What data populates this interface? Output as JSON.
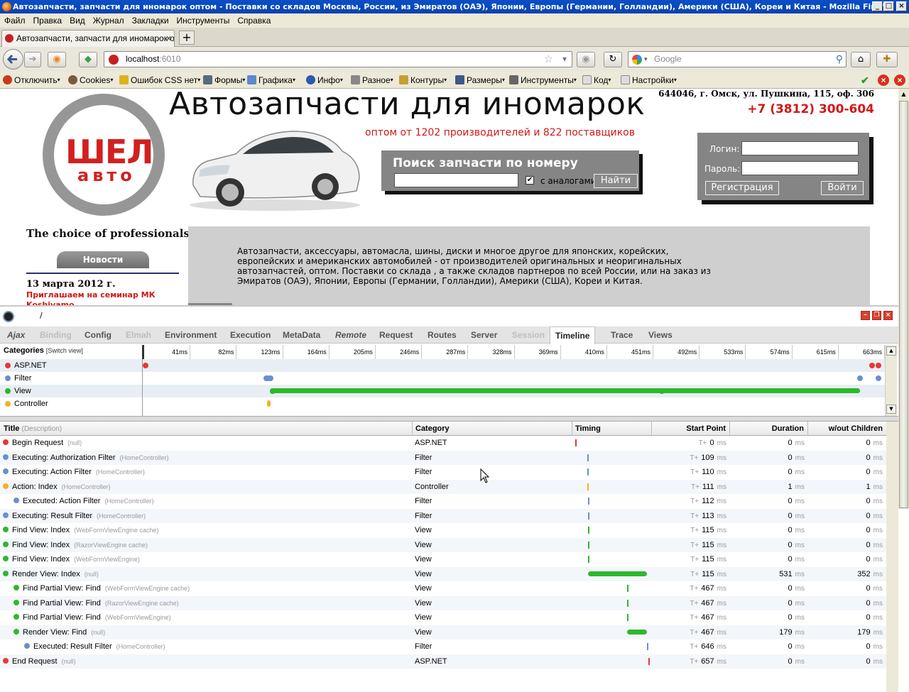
{
  "window": {
    "title": "Автозапчасти, запчасти для иномарок оптом - Поставки со складов Москвы, России, из Эмиратов (ОАЭ), Японии, Европы (Германии, Голландии), Америки (США), Кореи и Китая - Mozilla Firefox"
  },
  "menu": [
    "Файл",
    "Правка",
    "Вид",
    "Журнал",
    "Закладки",
    "Инструменты",
    "Справка"
  ],
  "tab": {
    "label": "Автозапчасти, запчасти для иномарок оп..."
  },
  "url": {
    "host": "localhost",
    "port": ":6010"
  },
  "search": {
    "placeholder": "Google"
  },
  "webdev": [
    "Отключить",
    "Cookies",
    "Ошибок CSS нет",
    "Формы",
    "Графика",
    "Инфо",
    "Разное",
    "Контуры",
    "Размеры",
    "Инструменты",
    "Код",
    "Настройки"
  ],
  "site": {
    "logo_main": "ШЕЛ",
    "logo_sub": "авто",
    "headline": "Автозапчасти для иномарок",
    "subhead": "оптом от 1202 производителей и 822 поставщиков",
    "address": "644046, г. Омск, ул. Пушкина, 115, оф. 306",
    "phone": "+7 (3812) 300-604",
    "search_title": "Поиск запчасти по номеру",
    "analogs": "с аналогами",
    "find": "Найти",
    "login_label": "Логин:",
    "password_label": "Пароль:",
    "register": "Регистрация",
    "login_btn": "Войти",
    "choice": "The choice of professionals",
    "news_btn": "Новости",
    "news_date": "13 марта 2012 г.",
    "news_link": "Приглашаем на семинар МК Koshivamo",
    "intro": "Автозапчасти, аксессуары, автомасла, шины, диски и многое другое для японских, корейских, европейских и американских автомобилей - от производителей оригинальных и неоригинальных автозапчастей, оптом. Поставки со склада , а также складов партнеров по всей России, или на заказ из Эмиратов (ОАЭ), Японии, Европы (Германии, Голландии), Америки (США), Кореи и Китая."
  },
  "glimpse": {
    "slash": "/",
    "tabs": [
      {
        "label": "Ajax",
        "state": "italic"
      },
      {
        "label": "Binding",
        "state": "disabled"
      },
      {
        "label": "Config",
        "state": "normal"
      },
      {
        "label": "Elmah",
        "state": "disabled"
      },
      {
        "label": "Environment",
        "state": "normal"
      },
      {
        "label": "Execution",
        "state": "normal"
      },
      {
        "label": "MetaData",
        "state": "normal"
      },
      {
        "label": "Remote",
        "state": "italic"
      },
      {
        "label": "Request",
        "state": "normal"
      },
      {
        "label": "Routes",
        "state": "normal"
      },
      {
        "label": "Server",
        "state": "normal"
      },
      {
        "label": "Session",
        "state": "disabled"
      },
      {
        "label": "Timeline",
        "state": "active"
      },
      {
        "label": "Trace",
        "state": "normal"
      },
      {
        "label": "Views",
        "state": "normal"
      }
    ],
    "categories_title": "Categories",
    "switch_view": "[Switch view]",
    "categories": [
      {
        "name": "ASP.NET",
        "color": "#e53935"
      },
      {
        "name": "Filter",
        "color": "#6a8fd0"
      },
      {
        "name": "View",
        "color": "#2db82d"
      },
      {
        "name": "Controller",
        "color": "#f2b12b"
      }
    ],
    "ticks": [
      "41ms",
      "82ms",
      "123ms",
      "164ms",
      "205ms",
      "246ms",
      "287ms",
      "328ms",
      "369ms",
      "410ms",
      "451ms",
      "492ms",
      "533ms",
      "574ms",
      "615ms",
      "663ms"
    ],
    "total_ms": 663,
    "columns": {
      "title": "Title",
      "desc": "(Description)",
      "category": "Category",
      "timing": "Timing",
      "start": "Start Point",
      "duration": "Duration",
      "without": "w/out Children"
    },
    "ms": "ms",
    "tplus": "T+",
    "events": [
      {
        "title": "Begin Request",
        "desc": "(null)",
        "cat": "ASP.NET",
        "start": 0,
        "duration": 0,
        "self": 0,
        "indent": 0
      },
      {
        "title": "Executing: Authorization Filter",
        "desc": "(HomeController)",
        "cat": "Filter",
        "start": 109,
        "duration": 0,
        "self": 0,
        "indent": 0
      },
      {
        "title": "Executing: Action Filter",
        "desc": "(HomeController)",
        "cat": "Filter",
        "start": 110,
        "duration": 0,
        "self": 0,
        "indent": 0
      },
      {
        "title": "Action: Index",
        "desc": "(HomeController)",
        "cat": "Controller",
        "start": 111,
        "duration": 1,
        "self": 1,
        "indent": 0
      },
      {
        "title": "Executed: Action Filter",
        "desc": "(HomeController)",
        "cat": "Filter",
        "start": 112,
        "duration": 0,
        "self": 0,
        "indent": 1
      },
      {
        "title": "Executing: Result Filter",
        "desc": "(HomeController)",
        "cat": "Filter",
        "start": 113,
        "duration": 0,
        "self": 0,
        "indent": 0
      },
      {
        "title": "Find View: Index",
        "desc": "(WebFormViewEngine cache)",
        "cat": "View",
        "start": 115,
        "duration": 0,
        "self": 0,
        "indent": 0
      },
      {
        "title": "Find View: Index",
        "desc": "(RazorViewEngine cache)",
        "cat": "View",
        "start": 115,
        "duration": 0,
        "self": 0,
        "indent": 0
      },
      {
        "title": "Find View: Index",
        "desc": "(WebFormViewEngine)",
        "cat": "View",
        "start": 115,
        "duration": 0,
        "self": 0,
        "indent": 0
      },
      {
        "title": "Render View: Index",
        "desc": "(null)",
        "cat": "View",
        "start": 115,
        "duration": 531,
        "self": 352,
        "indent": 0
      },
      {
        "title": "Find Partial View: Find",
        "desc": "(WebFormViewEngine cache)",
        "cat": "View",
        "start": 467,
        "duration": 0,
        "self": 0,
        "indent": 1
      },
      {
        "title": "Find Partial View: Find",
        "desc": "(RazorViewEngine cache)",
        "cat": "View",
        "start": 467,
        "duration": 0,
        "self": 0,
        "indent": 1
      },
      {
        "title": "Find Partial View: Find",
        "desc": "(WebFormViewEngine)",
        "cat": "View",
        "start": 467,
        "duration": 0,
        "self": 0,
        "indent": 1
      },
      {
        "title": "Render View: Find",
        "desc": "(null)",
        "cat": "View",
        "start": 467,
        "duration": 179,
        "self": 179,
        "indent": 1
      },
      {
        "title": "Executed: Result Filter",
        "desc": "(HomeController)",
        "cat": "Filter",
        "start": 646,
        "duration": 0,
        "self": 0,
        "indent": 2
      },
      {
        "title": "End Request",
        "desc": "(null)",
        "cat": "ASP.NET",
        "start": 657,
        "duration": 0,
        "self": 0,
        "indent": 0
      }
    ]
  }
}
